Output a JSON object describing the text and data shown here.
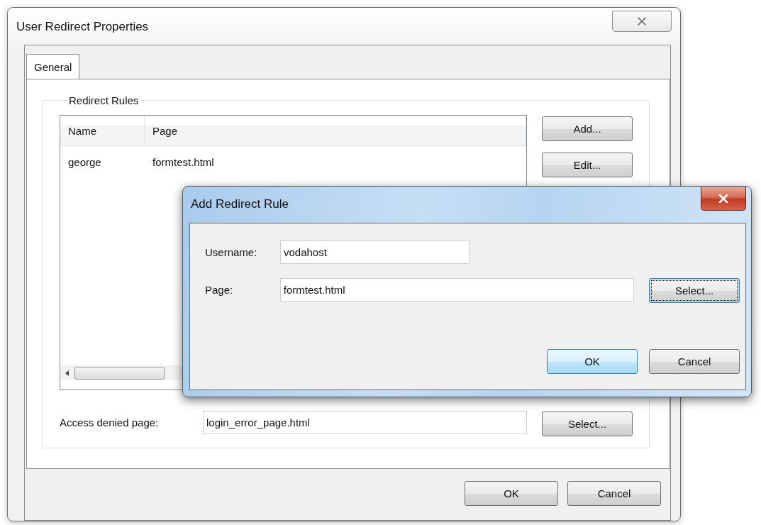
{
  "main_window": {
    "title": "User Redirect Properties",
    "tabs": [
      {
        "label": "General",
        "selected": true
      }
    ],
    "group": {
      "title": "Redirect Rules",
      "table": {
        "columns": [
          "Name",
          "Page"
        ],
        "rows": [
          [
            "george",
            "formtest.html"
          ]
        ]
      },
      "side_buttons": [
        "Add...",
        "Edit..."
      ],
      "access_denied": {
        "label": "Access denied page:",
        "value": "login_error_page.html",
        "button": "Select..."
      }
    },
    "buttons": [
      {
        "label": "OK"
      },
      {
        "label": "Cancel"
      }
    ]
  },
  "dialog": {
    "title": "Add Redirect Rule",
    "fields": [
      {
        "label": "Username:",
        "value": "vodahost"
      },
      {
        "label": "Page:",
        "value": "formtest.html"
      }
    ],
    "select_button": {
      "label": "Select...",
      "focused": true
    },
    "buttons": [
      {
        "label": "OK",
        "default": true
      },
      {
        "label": "Cancel",
        "default": false
      }
    ]
  }
}
